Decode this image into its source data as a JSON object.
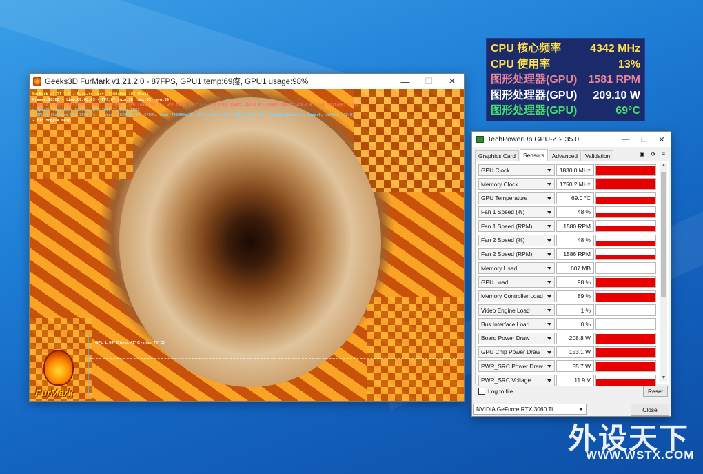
{
  "osd": {
    "rows": [
      {
        "label": "CPU 核心频率",
        "value": "4342 MHz",
        "color": "#ffe14a"
      },
      {
        "label": "CPU 使用率",
        "value": "13%",
        "color": "#ffe14a"
      },
      {
        "label": "图形处理器(GPU)",
        "value": "1581 RPM",
        "color": "#e9849a"
      },
      {
        "label": "图形处理器(GPU)",
        "value": "209.10 W",
        "color": "#ffffff"
      },
      {
        "label": "图形处理器(GPU)",
        "value": "69°C",
        "color": "#42e06a"
      }
    ]
  },
  "furmark": {
    "title": "Geeks3D FurMark v1.21.2.0 - 87FPS, GPU1 temp:69癈, GPU1 usage:98%",
    "overlay": {
      "line1": "FurMark v1.21.2.0 - Burn-in test, 1280x960 (8X MSAA)",
      "line2": "Frames:16300 - time:00:03:03 - FPS:87 (min:58, max:93, avg:89)",
      "line3": "[ GPU-Z ] core: 1845 MHz - mem: 1750 MHz - GPU load: 98 % - GPU temp: 69 ° C - GPU chip power: 153.0 W - Board power: 209.4 W - GPU voltage: 0.962 V",
      "line4": "> OpenGL renderer: GeForce RTX 3060 Ti/PCIe/SSE2",
      "line5": "> GPU 1 (GeForce RTX 3060 Ti) - core: 1830MHz/69° C/98%, mem: 7000MHz/2%, GPU power: 95.9% TDP, fan: 48%, limits:[power:1, temp:0, volt:0, OV:0]",
      "line6": "- F1: toggle help"
    },
    "graph_label": "GPU 1: 69° C (min: 41° C - max: 70° C)",
    "logo_text": "FurMark"
  },
  "gpuz": {
    "title": "TechPowerUp GPU-Z 2.35.0",
    "tabs": [
      "Graphics Card",
      "Sensors",
      "Advanced",
      "Validation"
    ],
    "active_tab": "Sensors",
    "sensors": [
      {
        "name": "GPU Clock",
        "value": "1830.0 MHz",
        "level": 0.93
      },
      {
        "name": "Memory Clock",
        "value": "1750.2 MHz",
        "level": 0.95
      },
      {
        "name": "GPU Temperature",
        "value": "69.0 °C",
        "level": 0.55
      },
      {
        "name": "Fan 1 Speed (%)",
        "value": "48 %",
        "level": 0.45
      },
      {
        "name": "Fan 1 Speed (RPM)",
        "value": "1580 RPM",
        "level": 0.45
      },
      {
        "name": "Fan 2 Speed (%)",
        "value": "48 %",
        "level": 0.45
      },
      {
        "name": "Fan 2 Speed (RPM)",
        "value": "1586 RPM",
        "level": 0.45
      },
      {
        "name": "Memory Used",
        "value": "607 MB",
        "level": 0.05
      },
      {
        "name": "GPU Load",
        "value": "98 %",
        "level": 0.92
      },
      {
        "name": "Memory Controller Load",
        "value": "89 %",
        "level": 0.88
      },
      {
        "name": "Video Engine Load",
        "value": "1 %",
        "level": 0.0
      },
      {
        "name": "Bus Interface Load",
        "value": "0 %",
        "level": 0.0
      },
      {
        "name": "Board Power Draw",
        "value": "208.8 W",
        "level": 0.9
      },
      {
        "name": "GPU Chip Power Draw",
        "value": "153.1 W",
        "level": 0.9
      },
      {
        "name": "PWR_SRC Power Draw",
        "value": "55.7 W",
        "level": 0.9
      },
      {
        "name": "PWR_SRC Voltage",
        "value": "11.9 V",
        "level": 0.6
      }
    ],
    "log_to_file": "Log to file",
    "reset": "Reset",
    "device": "NVIDIA GeForce RTX 3060 Ti",
    "close": "Close"
  },
  "watermark": {
    "cn": "外设天下",
    "en": "WWW.WSTX.COM"
  }
}
